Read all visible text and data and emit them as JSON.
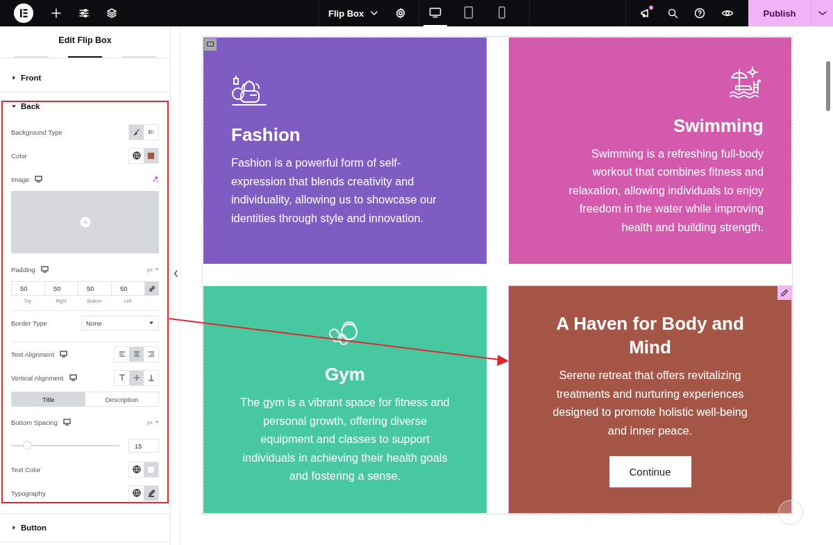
{
  "topbar": {
    "document_title": "Flip Box",
    "devices": [
      {
        "selected": true
      },
      {
        "selected": false
      },
      {
        "selected": false
      }
    ],
    "notifications_unread": true,
    "publish": "Publish"
  },
  "panel": {
    "title": "Edit Flip Box",
    "tabs": [
      {
        "selected": false
      },
      {
        "selected": true
      },
      {
        "selected": false
      }
    ],
    "sections": [
      {
        "title": "Front",
        "expanded": false
      },
      {
        "title": "Back",
        "expanded": true,
        "controls": [
          {
            "kind": "background-type",
            "label": "Background Type",
            "options": [
              {
                "selected": true
              },
              {
                "selected": false
              }
            ]
          },
          {
            "kind": "color",
            "label": "Color",
            "color": "#a65646"
          },
          {
            "kind": "image",
            "label": "Image",
            "responsive": true
          },
          {
            "kind": "dimensions",
            "label": "Padding",
            "responsive": true,
            "unit": "px",
            "linked": true,
            "fields": [
              {
                "value": "50",
                "caption": "Top"
              },
              {
                "value": "50",
                "caption": "Right"
              },
              {
                "value": "50",
                "caption": "Bottom"
              },
              {
                "value": "50",
                "caption": "Left"
              }
            ]
          },
          {
            "kind": "select",
            "label": "Border Type",
            "value": "None"
          },
          {
            "kind": "text-align",
            "label": "Text Alignment",
            "responsive": true,
            "options": [
              {
                "selected": false
              },
              {
                "selected": true
              },
              {
                "selected": false
              }
            ]
          },
          {
            "kind": "vertical-align",
            "label": "Vertical Alignment",
            "responsive": true,
            "options": [
              {
                "selected": false
              },
              {
                "selected": true
              },
              {
                "selected": false
              }
            ]
          },
          {
            "kind": "switcher",
            "options": [
              {
                "label": "Title",
                "selected": true
              },
              {
                "label": "Description",
                "selected": false
              }
            ]
          },
          {
            "kind": "slider",
            "label": "Bottom Spacing",
            "responsive": true,
            "unit": "px",
            "level": 0.15,
            "value": "15"
          },
          {
            "kind": "color",
            "label": "Text Color",
            "color": "#ffffff"
          },
          {
            "kind": "typography",
            "label": "Typography",
            "edited": true
          }
        ]
      },
      {
        "title": "Button",
        "expanded": false
      }
    ]
  },
  "cards": [
    {
      "kind": "front",
      "centered": false,
      "right_aligned": false,
      "color": "#7f5cc2",
      "selected": false,
      "title": "Fashion",
      "description": "Fashion is a powerful form of self-expression that blends creativity and individuality, allowing us to showcase our identities through style and innovation."
    },
    {
      "kind": "front",
      "centered": false,
      "right_aligned": true,
      "color": "#d45aae",
      "selected": false,
      "title": "Swimming",
      "description": "Swimming is a refreshing full-body workout that combines fitness and relaxation, allowing individuals to enjoy freedom in the water while improving health and building strength."
    },
    {
      "kind": "front",
      "centered": true,
      "right_aligned": false,
      "color": "#47c8a1",
      "selected": false,
      "title": "Gym",
      "description": "The gym is a vibrant space for fitness and personal growth, offering diverse equipment and classes to support individuals in achieving their health goals and fostering a sense."
    },
    {
      "kind": "back",
      "centered": true,
      "right_aligned": false,
      "color": "#a65646",
      "selected": true,
      "title": "A Haven for Body and Mind",
      "description": "Serene retreat that offers revitalizing treatments and nurturing experiences designed to promote holistic well-being and inner peace.",
      "button": "Continue"
    }
  ]
}
